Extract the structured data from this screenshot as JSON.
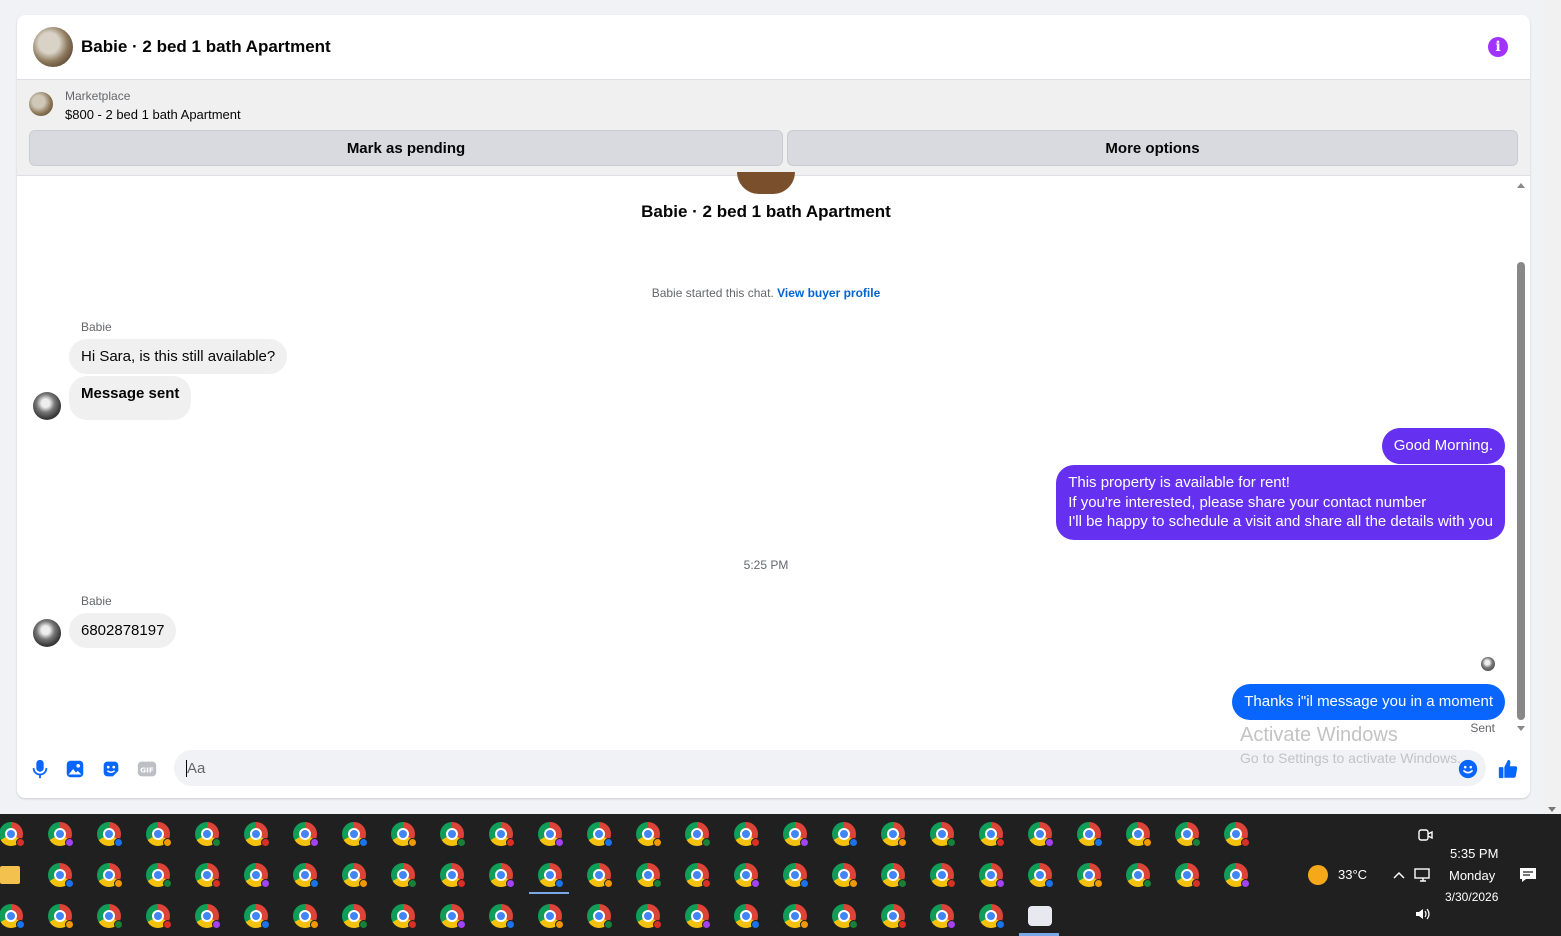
{
  "header": {
    "title": "Babie · 2 bed 1 bath Apartment",
    "info_icon": "info-icon"
  },
  "listing": {
    "label": "Marketplace",
    "price_title": "$800 - 2 bed 1 bath Apartment",
    "mark_pending_label": "Mark as pending",
    "more_options_label": "More options"
  },
  "chat": {
    "title": "Babie · 2 bed 1 bath Apartment",
    "started_text": "Babie started this chat.",
    "buyer_profile_link": "View buyer profile",
    "messages": [
      {
        "sender": "Babie",
        "text": "Hi Sara, is this still available?",
        "direction": "in"
      },
      {
        "text": "Message sent",
        "direction": "in"
      },
      {
        "text": "Good Morning.",
        "direction": "out"
      },
      {
        "lines": [
          "This property is available for rent!",
          "If you're interested, please share your contact number",
          "I'll be happy to schedule a visit and share all the details with you"
        ],
        "direction": "out"
      },
      {
        "sender": "Babie",
        "text": "6802878197",
        "direction": "in"
      },
      {
        "text": "Thanks i\"il message you in a moment",
        "direction": "out",
        "status": "Sent"
      }
    ],
    "time_divider": "5:25 PM"
  },
  "composer": {
    "placeholder": "Aa",
    "icons": [
      "microphone-icon",
      "image-icon",
      "sticker-icon",
      "gif-icon",
      "emoji-icon",
      "thumbs-up-icon"
    ],
    "gif_label": "GIF"
  },
  "watermark": {
    "line1": "Activate Windows",
    "line2": "Go to Settings to activate Windows."
  },
  "taskbar": {
    "weather": "33°C",
    "time": "5:35 PM",
    "day": "Monday",
    "date": "3/30/2026"
  },
  "colors": {
    "outgoing_purple": "#6530f0",
    "outgoing_blue": "#0866ff",
    "link_blue": "#0064d1",
    "info_purple": "#a033ff"
  }
}
